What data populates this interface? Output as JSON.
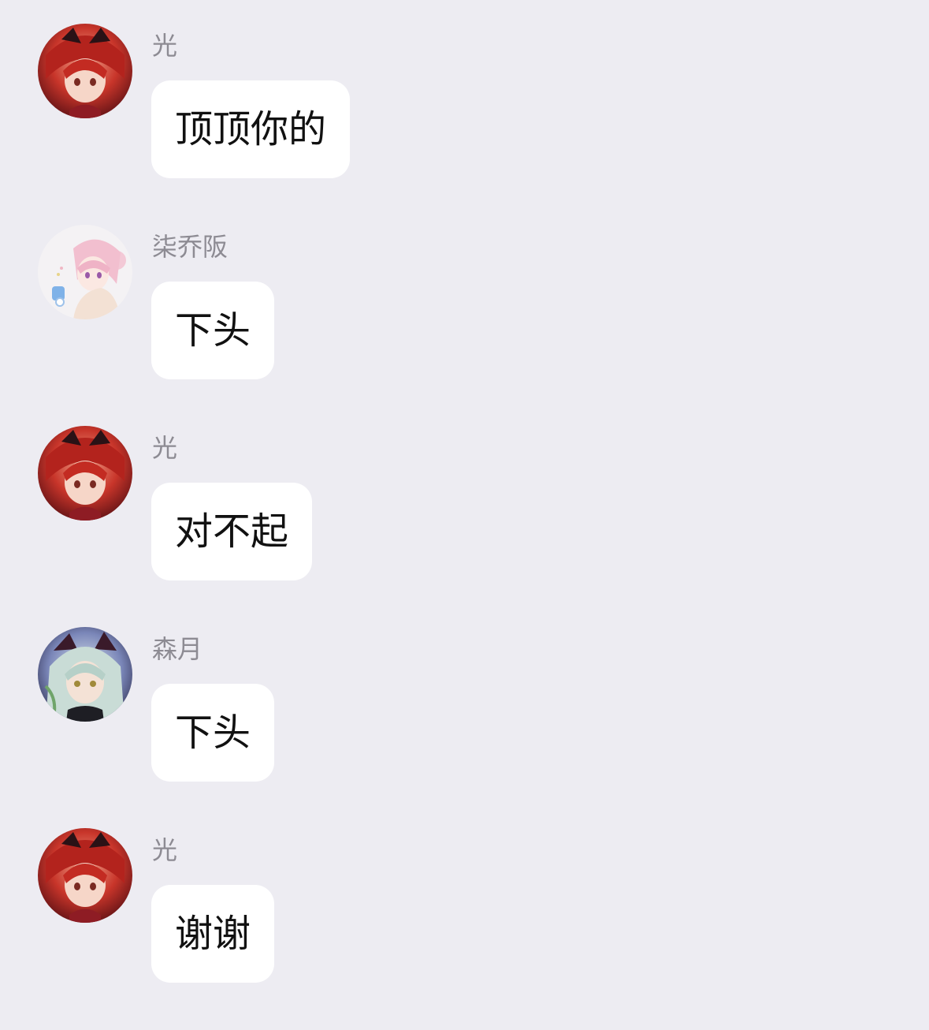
{
  "colors": {
    "background": "#edecf2",
    "bubble": "#ffffff",
    "sender_name": "#8d8b93",
    "message_text": "#111111"
  },
  "messages": [
    {
      "sender": "光",
      "avatar": "red-haired-anime-avatar",
      "text": "顶顶你的"
    },
    {
      "sender": "柒乔阪",
      "avatar": "pink-haired-anime-avatar",
      "text": "下头"
    },
    {
      "sender": "光",
      "avatar": "red-haired-anime-avatar",
      "text": "对不起"
    },
    {
      "sender": "森月",
      "avatar": "silver-haired-anime-avatar",
      "text": "下头"
    },
    {
      "sender": "光",
      "avatar": "red-haired-anime-avatar",
      "text": "谢谢"
    }
  ]
}
